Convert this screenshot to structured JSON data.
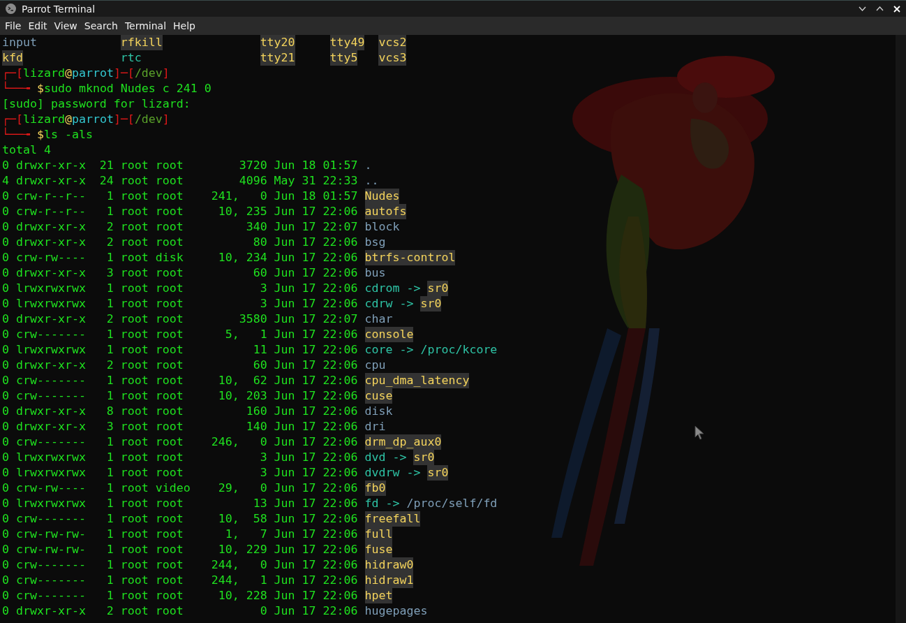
{
  "window": {
    "title": "Parrot Terminal"
  },
  "menu": [
    "File",
    "Edit",
    "View",
    "Search",
    "Terminal",
    "Help"
  ],
  "lines": [
    {
      "kind": "columns",
      "cells": [
        {
          "text": "input",
          "kind": "dir"
        },
        {
          "text": "rfkill",
          "kind": "device"
        },
        {
          "text": "tty20",
          "kind": "device"
        },
        {
          "text": "tty49",
          "kind": "device"
        },
        {
          "text": "vcs2",
          "kind": "device"
        }
      ]
    },
    {
      "kind": "columns",
      "cells": [
        {
          "text": "kfd",
          "kind": "device"
        },
        {
          "text": "rtc",
          "kind": "link"
        },
        {
          "text": "tty21",
          "kind": "device"
        },
        {
          "text": "tty5",
          "kind": "device"
        },
        {
          "text": "vcs3",
          "kind": "device"
        }
      ]
    },
    {
      "kind": "prompt",
      "segments": [
        {
          "text": "┌─[",
          "kind": "frame"
        },
        {
          "text": "lizard",
          "kind": "user"
        },
        {
          "text": "@",
          "kind": "at"
        },
        {
          "text": "parrot",
          "kind": "host"
        },
        {
          "text": "]─[",
          "kind": "frame"
        },
        {
          "text": "/dev",
          "kind": "path"
        },
        {
          "text": "]",
          "kind": "frame"
        }
      ]
    },
    {
      "kind": "prompt",
      "segments": [
        {
          "text": "└──╼ ",
          "kind": "frame"
        },
        {
          "text": "$",
          "kind": "dollar"
        },
        {
          "text": "sudo mknod Nudes c 241 0",
          "kind": "command"
        }
      ]
    },
    {
      "kind": "output",
      "text": "[sudo] password for lizard:"
    },
    {
      "kind": "prompt",
      "segments": [
        {
          "text": "┌─[",
          "kind": "frame"
        },
        {
          "text": "lizard",
          "kind": "user"
        },
        {
          "text": "@",
          "kind": "at"
        },
        {
          "text": "parrot",
          "kind": "host"
        },
        {
          "text": "]─[",
          "kind": "frame"
        },
        {
          "text": "/dev",
          "kind": "path"
        },
        {
          "text": "]",
          "kind": "frame"
        }
      ]
    },
    {
      "kind": "prompt",
      "segments": [
        {
          "text": "└──╼ ",
          "kind": "frame"
        },
        {
          "text": "$",
          "kind": "dollar"
        },
        {
          "text": "ls -als",
          "kind": "command"
        }
      ]
    },
    {
      "kind": "output",
      "text": "total 4"
    },
    {
      "kind": "entry",
      "info": "0 drwxr-xr-x  21 root root        3720 Jun 18 01:57",
      "name": {
        "text": ".",
        "kind": "dir"
      }
    },
    {
      "kind": "entry",
      "info": "4 drwxr-xr-x  24 root root        4096 May 31 22:33",
      "name": {
        "text": "..",
        "kind": "dir"
      }
    },
    {
      "kind": "entry",
      "info": "0 crw-r--r--   1 root root    241,   0 Jun 18 01:57",
      "name": {
        "text": "Nudes",
        "kind": "device"
      }
    },
    {
      "kind": "entry",
      "info": "0 crw-r--r--   1 root root     10, 235 Jun 17 22:06",
      "name": {
        "text": "autofs",
        "kind": "device"
      }
    },
    {
      "kind": "entry",
      "info": "0 drwxr-xr-x   2 root root         340 Jun 17 22:07",
      "name": {
        "text": "block",
        "kind": "dir"
      }
    },
    {
      "kind": "entry",
      "info": "0 drwxr-xr-x   2 root root          80 Jun 17 22:06",
      "name": {
        "text": "bsg",
        "kind": "dir"
      }
    },
    {
      "kind": "entry",
      "info": "0 crw-rw----   1 root disk     10, 234 Jun 17 22:06",
      "name": {
        "text": "btrfs-control",
        "kind": "device"
      }
    },
    {
      "kind": "entry",
      "info": "0 drwxr-xr-x   3 root root          60 Jun 17 22:06",
      "name": {
        "text": "bus",
        "kind": "dir"
      }
    },
    {
      "kind": "entry",
      "info": "0 lrwxrwxrwx   1 root root           3 Jun 17 22:06",
      "name": {
        "text": "cdrom",
        "kind": "link"
      },
      "arrow": "->",
      "target": {
        "text": "sr0",
        "kind": "device"
      }
    },
    {
      "kind": "entry",
      "info": "0 lrwxrwxrwx   1 root root           3 Jun 17 22:06",
      "name": {
        "text": "cdrw",
        "kind": "link"
      },
      "arrow": "->",
      "target": {
        "text": "sr0",
        "kind": "device"
      }
    },
    {
      "kind": "entry",
      "info": "0 drwxr-xr-x   2 root root        3580 Jun 17 22:07",
      "name": {
        "text": "char",
        "kind": "dir"
      }
    },
    {
      "kind": "entry",
      "info": "0 crw-------   1 root root      5,   1 Jun 17 22:06",
      "name": {
        "text": "console",
        "kind": "device"
      }
    },
    {
      "kind": "entry",
      "info": "0 lrwxrwxrwx   1 root root          11 Jun 17 22:06",
      "name": {
        "text": "core",
        "kind": "link"
      },
      "arrow": "->",
      "target": {
        "text": "/proc/kcore",
        "kind": "link"
      }
    },
    {
      "kind": "entry",
      "info": "0 drwxr-xr-x   2 root root          60 Jun 17 22:06",
      "name": {
        "text": "cpu",
        "kind": "dir"
      }
    },
    {
      "kind": "entry",
      "info": "0 crw-------   1 root root     10,  62 Jun 17 22:06",
      "name": {
        "text": "cpu_dma_latency",
        "kind": "device"
      }
    },
    {
      "kind": "entry",
      "info": "0 crw-------   1 root root     10, 203 Jun 17 22:06",
      "name": {
        "text": "cuse",
        "kind": "device"
      }
    },
    {
      "kind": "entry",
      "info": "0 drwxr-xr-x   8 root root         160 Jun 17 22:06",
      "name": {
        "text": "disk",
        "kind": "dir"
      }
    },
    {
      "kind": "entry",
      "info": "0 drwxr-xr-x   3 root root         140 Jun 17 22:06",
      "name": {
        "text": "dri",
        "kind": "dir"
      }
    },
    {
      "kind": "entry",
      "info": "0 crw-------   1 root root    246,   0 Jun 17 22:06",
      "name": {
        "text": "drm_dp_aux0",
        "kind": "device"
      }
    },
    {
      "kind": "entry",
      "info": "0 lrwxrwxrwx   1 root root           3 Jun 17 22:06",
      "name": {
        "text": "dvd",
        "kind": "link"
      },
      "arrow": "->",
      "target": {
        "text": "sr0",
        "kind": "device"
      }
    },
    {
      "kind": "entry",
      "info": "0 lrwxrwxrwx   1 root root           3 Jun 17 22:06",
      "name": {
        "text": "dvdrw",
        "kind": "link"
      },
      "arrow": "->",
      "target": {
        "text": "sr0",
        "kind": "device"
      }
    },
    {
      "kind": "entry",
      "info": "0 crw-rw----   1 root video    29,   0 Jun 17 22:06",
      "name": {
        "text": "fb0",
        "kind": "device"
      }
    },
    {
      "kind": "entry",
      "info": "0 lrwxrwxrwx   1 root root          13 Jun 17 22:06",
      "name": {
        "text": "fd",
        "kind": "link"
      },
      "arrow": "->",
      "target": {
        "text": "/proc/self/fd",
        "kind": "dir"
      }
    },
    {
      "kind": "entry",
      "info": "0 crw-------   1 root root     10,  58 Jun 17 22:06",
      "name": {
        "text": "freefall",
        "kind": "device"
      }
    },
    {
      "kind": "entry",
      "info": "0 crw-rw-rw-   1 root root      1,   7 Jun 17 22:06",
      "name": {
        "text": "full",
        "kind": "device"
      }
    },
    {
      "kind": "entry",
      "info": "0 crw-rw-rw-   1 root root     10, 229 Jun 17 22:06",
      "name": {
        "text": "fuse",
        "kind": "device"
      }
    },
    {
      "kind": "entry",
      "info": "0 crw-------   1 root root    244,   0 Jun 17 22:06",
      "name": {
        "text": "hidraw0",
        "kind": "device"
      }
    },
    {
      "kind": "entry",
      "info": "0 crw-------   1 root root    244,   1 Jun 17 22:06",
      "name": {
        "text": "hidraw1",
        "kind": "device"
      }
    },
    {
      "kind": "entry",
      "info": "0 crw-------   1 root root     10, 228 Jun 17 22:06",
      "name": {
        "text": "hpet",
        "kind": "device"
      }
    },
    {
      "kind": "entry",
      "info": "0 drwxr-xr-x   2 root root           0 Jun 17 22:06",
      "name": {
        "text": "hugepages",
        "kind": "dir"
      }
    }
  ]
}
